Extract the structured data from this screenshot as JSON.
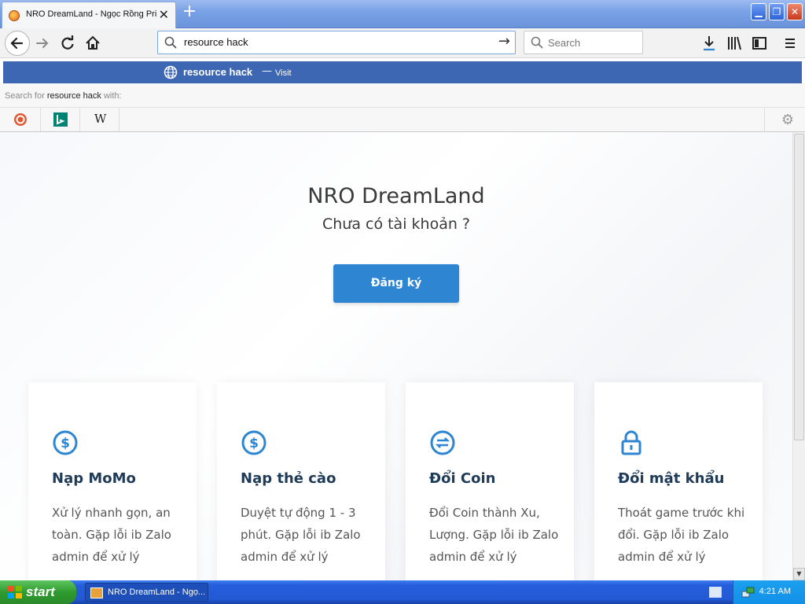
{
  "browser": {
    "tab_title": "NRO DreamLand - Ngọc Rồng Private",
    "new_tab_symbol": "+",
    "url_value": "resource hack",
    "search_placeholder": "Search"
  },
  "suggestion": {
    "main_text": "resource hack",
    "dash": "—",
    "action": "Visit",
    "search_for_prefix": "Search for",
    "search_for_term": "resource hack",
    "search_for_suffix": "with:"
  },
  "page": {
    "title": "NRO DreamLand",
    "subtitle": "Chưa có tài khoản ?",
    "register_label": "Đăng ký",
    "accent_color": "#2e86d3",
    "cards": [
      {
        "icon": "dollar-circle-icon",
        "title": "Nạp MoMo",
        "desc": "Xử lý nhanh gọn, an toàn. Gặp lỗi ib Zalo admin để xử lý"
      },
      {
        "icon": "dollar-circle-icon",
        "title": "Nạp thẻ cào",
        "desc": "Duyệt tự động 1 - 3 phút. Gặp lỗi ib Zalo admin để xử lý"
      },
      {
        "icon": "exchange-circle-icon",
        "title": "Đổi Coin",
        "desc": "Đổi Coin thành Xu, Lượng. Gặp lỗi ib Zalo admin để xử lý"
      },
      {
        "icon": "lock-icon",
        "title": "Đổi mật khẩu",
        "desc": "Thoát game trước khi đổi. Gặp lỗi ib Zalo admin để xử lý"
      }
    ]
  },
  "taskbar": {
    "start_label": "start",
    "task_label": "NRO DreamLand - Ngọ...",
    "clock": "4:21 AM"
  }
}
